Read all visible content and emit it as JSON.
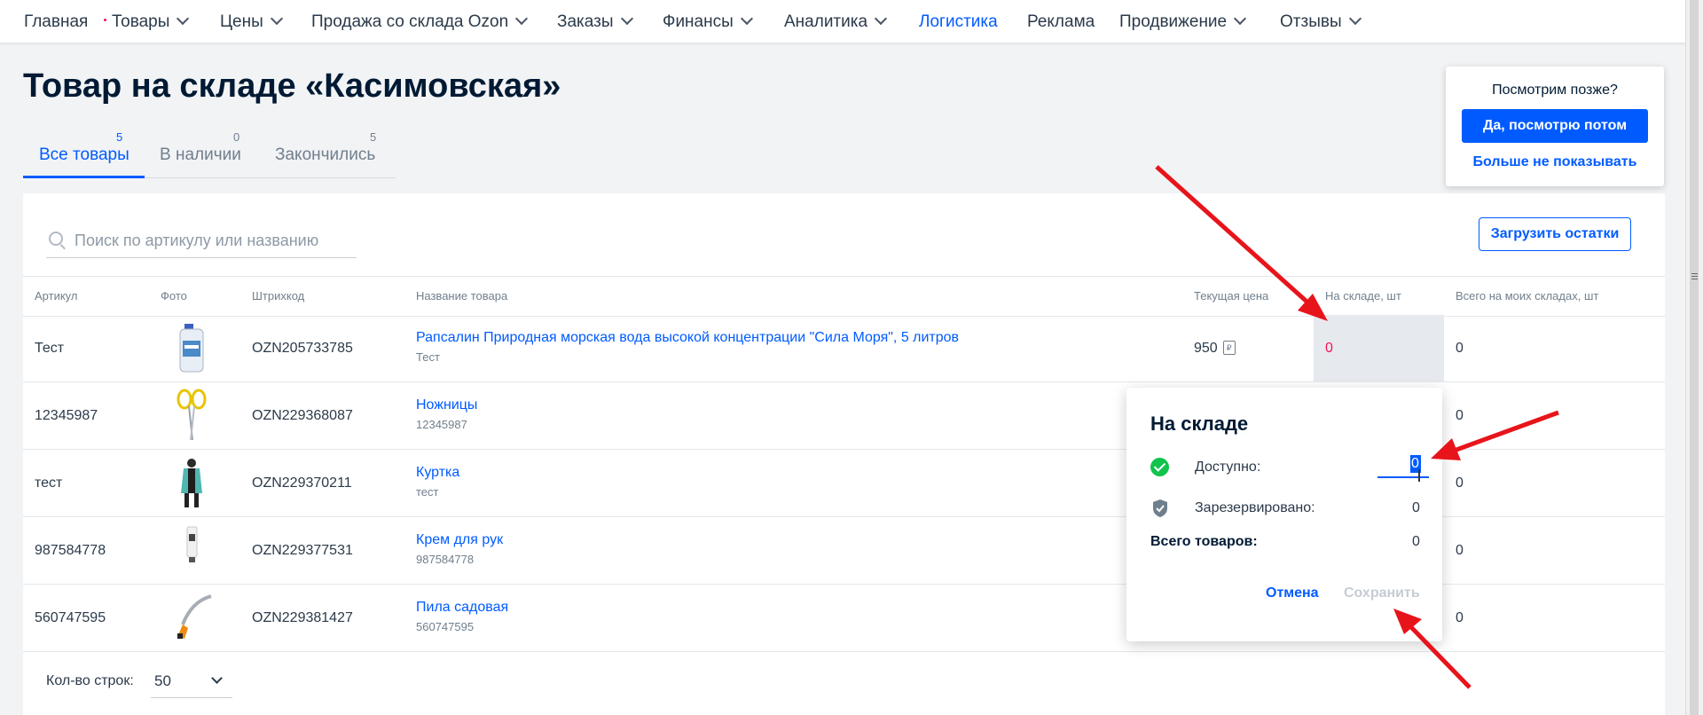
{
  "nav": {
    "items": [
      {
        "label": "Главная",
        "chevron": false,
        "active": false,
        "dot": false
      },
      {
        "label": "Товары",
        "chevron": true,
        "active": false,
        "dot": true
      },
      {
        "label": "Цены",
        "chevron": true,
        "active": false,
        "dot": false
      },
      {
        "label": "Продажа со склада Ozon",
        "chevron": true,
        "active": false,
        "dot": false
      },
      {
        "label": "Заказы",
        "chevron": true,
        "active": false,
        "dot": false
      },
      {
        "label": "Финансы",
        "chevron": true,
        "active": false,
        "dot": false
      },
      {
        "label": "Аналитика",
        "chevron": true,
        "active": false,
        "dot": false
      },
      {
        "label": "Логистика",
        "chevron": false,
        "active": true,
        "dot": false
      },
      {
        "label": "Реклама",
        "chevron": false,
        "active": false,
        "dot": false
      },
      {
        "label": "Продвижение",
        "chevron": true,
        "active": false,
        "dot": false
      },
      {
        "label": "Отзывы",
        "chevron": true,
        "active": false,
        "dot": false
      }
    ]
  },
  "page": {
    "title": "Товар на складе «Касимовская»"
  },
  "tabs": [
    {
      "label": "Все товары",
      "count": "5",
      "active": true
    },
    {
      "label": "В наличии",
      "count": "0",
      "active": false
    },
    {
      "label": "Закончились",
      "count": "5",
      "active": false
    }
  ],
  "search": {
    "placeholder": "Поиск по артикулу или названию",
    "value": ""
  },
  "upload_button": "Загрузить остатки",
  "table": {
    "columns": [
      "Артикул",
      "Фото",
      "Штрихкод",
      "Название товара",
      "Текущая цена",
      "На складе, шт",
      "Всего на моих складах, шт"
    ],
    "rows": [
      {
        "article": "Тест",
        "photo": "water-bottle",
        "barcode": "OZN205733785",
        "name": "Рапсалин Природная морская вода высокой концентрации \"Сила Моря\", 5 литров",
        "sub": "Тест",
        "price": "950",
        "price_icon": "ruble-icon",
        "stock": "0",
        "total": "0"
      },
      {
        "article": "12345987",
        "photo": "scissors",
        "barcode": "OZN229368087",
        "name": "Ножницы",
        "sub": "12345987",
        "price": "",
        "stock": "",
        "total": "0"
      },
      {
        "article": "тест",
        "photo": "jacket",
        "barcode": "OZN229370211",
        "name": "Куртка",
        "sub": "тест",
        "price": "",
        "stock": "",
        "total": "0"
      },
      {
        "article": "987584778",
        "photo": "hand-cream",
        "barcode": "OZN229377531",
        "name": "Крем для рук",
        "sub": "987584778",
        "price": "",
        "stock": "",
        "total": "0"
      },
      {
        "article": "560747595",
        "photo": "garden-saw",
        "barcode": "OZN229381427",
        "name": "Пила садовая",
        "sub": "560747595",
        "price": "",
        "stock": "",
        "total": "0"
      }
    ]
  },
  "footer": {
    "rows_label": "Кол-во строк:",
    "rows_value": "50"
  },
  "later_popup": {
    "title": "Посмотрим позже?",
    "yes_button": "Да, посмотрю потом",
    "no_link": "Больше не показывать"
  },
  "stock_popup": {
    "title": "На складе",
    "available_label": "Доступно:",
    "available_value": "0",
    "reserved_label": "Зарезервировано:",
    "reserved_value": "0",
    "total_label": "Всего товаров:",
    "total_value": "0",
    "cancel": "Отмена",
    "save": "Сохранить"
  },
  "colors": {
    "accent": "#005bff",
    "stock_zero": "#f91155",
    "annotation": "#e8141b",
    "success": "#10c44c"
  }
}
